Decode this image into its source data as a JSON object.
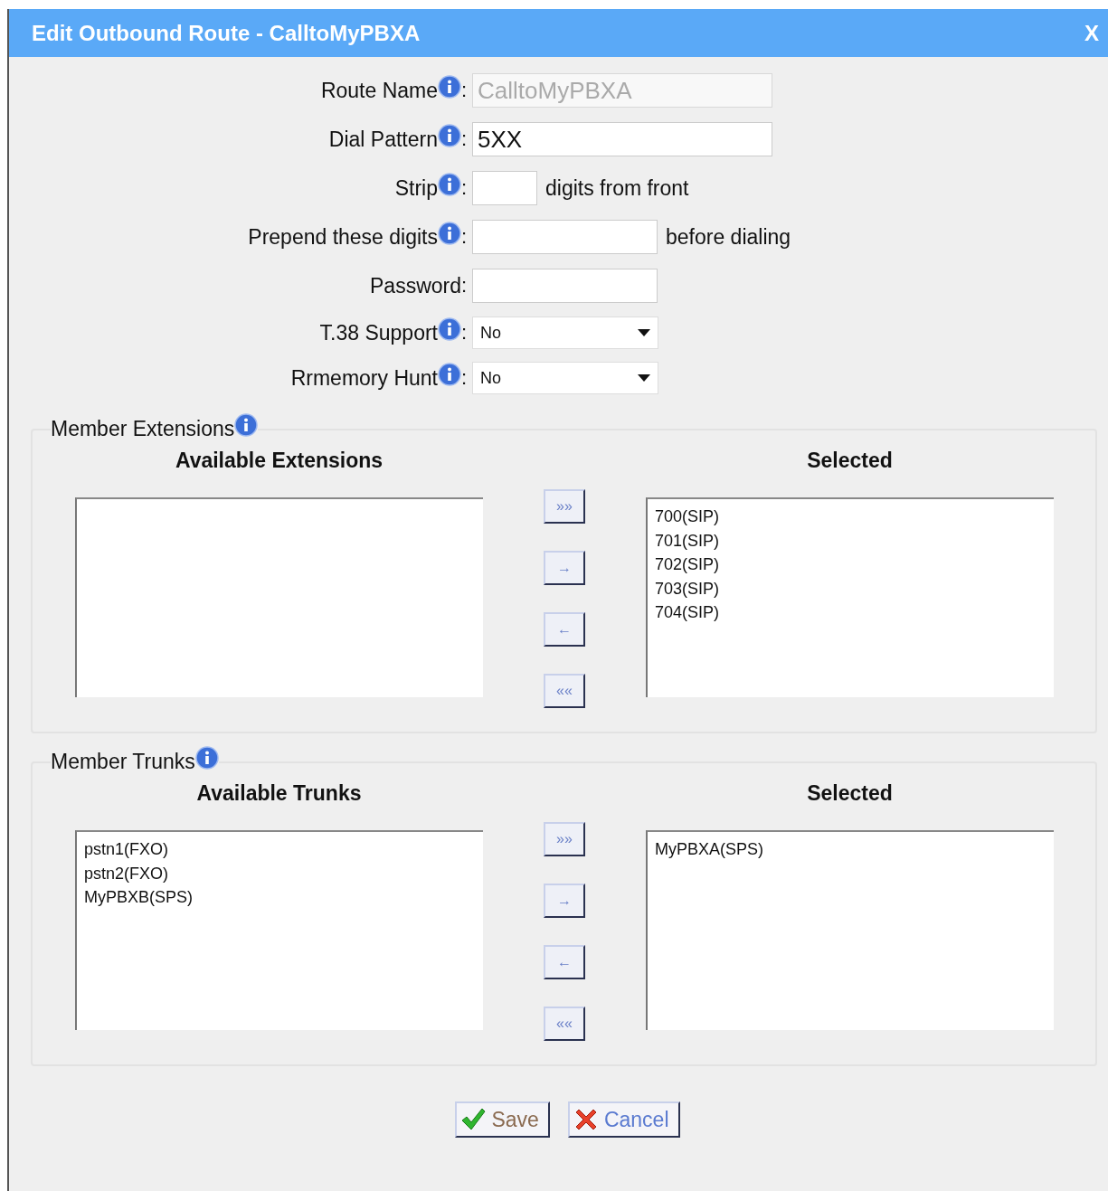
{
  "dialog": {
    "title": "Edit Outbound Route - CalltoMyPBXA",
    "close": "X"
  },
  "fields": [
    {
      "kind": "text",
      "label": "Route Name",
      "info": true,
      "separator": ":",
      "value": "CalltoMyPBXA",
      "disabled": true
    },
    {
      "kind": "text",
      "label": "Dial Pattern",
      "info": true,
      "separator": ":",
      "value": "5XX",
      "disabled": false
    },
    {
      "kind": "text",
      "label": "Strip",
      "info": true,
      "separator": ":",
      "disabled": false,
      "suffix": "digits from front"
    },
    {
      "kind": "text",
      "label": "Prepend these digits",
      "info": true,
      "separator": ":",
      "disabled": false,
      "suffix": "before dialing"
    },
    {
      "kind": "text",
      "label": "Password",
      "info": false,
      "separator": ":",
      "disabled": false
    },
    {
      "kind": "select",
      "label": "T.38 Support",
      "info": true,
      "separator": ":",
      "value": "No"
    },
    {
      "kind": "select",
      "label": "Rrmemory Hunt",
      "info": true,
      "separator": ":",
      "value": "No"
    }
  ],
  "members": [
    {
      "legend": "Member Extensions",
      "available_title": "Available Extensions",
      "selected_title": "Selected",
      "buttons": [
        "»»",
        "→",
        "←",
        "««"
      ],
      "selected": [
        "700(SIP)",
        "701(SIP)",
        "702(SIP)",
        "703(SIP)",
        "704(SIP)"
      ]
    },
    {
      "legend": "Member Trunks",
      "available_title": "Available Trunks",
      "selected_title": "Selected",
      "buttons": [
        "»»",
        "→",
        "←",
        "««"
      ],
      "available": [
        "pstn1(FXO)",
        "pstn2(FXO)",
        "MyPBXB(SPS)"
      ],
      "selected": [
        "MyPBXA(SPS)"
      ]
    }
  ],
  "actions": [
    {
      "kind": "save",
      "label": "Save"
    },
    {
      "kind": "cancel",
      "label": "Cancel"
    }
  ]
}
